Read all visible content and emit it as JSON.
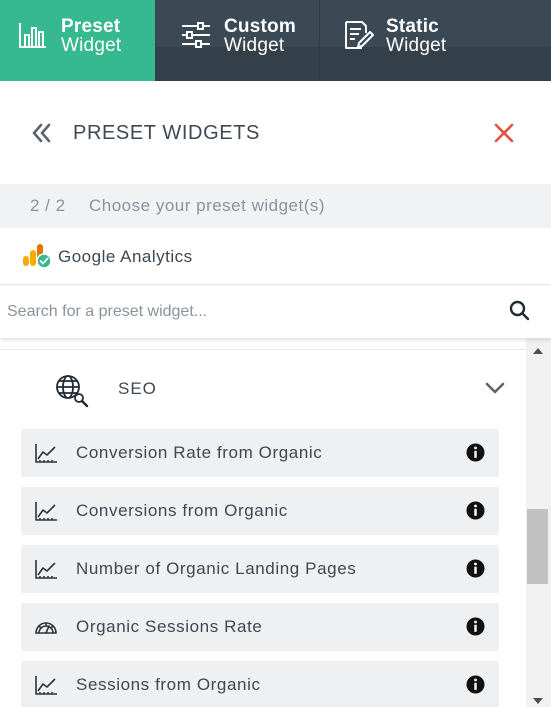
{
  "tabs": [
    {
      "title": "Preset",
      "sub": "Widget",
      "icon": "bar-chart-icon",
      "active": true
    },
    {
      "title": "Custom",
      "sub": "Widget",
      "icon": "sliders-icon",
      "active": false
    },
    {
      "title": "Static",
      "sub": "Widget",
      "icon": "edit-document-icon",
      "active": false
    }
  ],
  "header": {
    "title": "PRESET WIDGETS",
    "back_icon": "double-chevron-left-icon",
    "close_icon": "close-icon"
  },
  "step": {
    "count": "2 / 2",
    "text": "Choose your preset widget(s)"
  },
  "source": {
    "name": "Google Analytics",
    "icon": "google-analytics-icon"
  },
  "search": {
    "placeholder": "Search for a preset widget...",
    "value": ""
  },
  "category": {
    "label": "SEO",
    "icon": "globe-search-icon",
    "expanded": true
  },
  "widgets": [
    {
      "label": "Conversion Rate from Organic",
      "icon": "trend-line-icon"
    },
    {
      "label": "Conversions from Organic",
      "icon": "trend-line-icon"
    },
    {
      "label": "Number of Organic Landing Pages",
      "icon": "trend-line-icon"
    },
    {
      "label": "Organic Sessions Rate",
      "icon": "gauge-icon"
    },
    {
      "label": "Sessions from Organic",
      "icon": "trend-line-icon"
    }
  ],
  "colors": {
    "accent": "#36b98e",
    "tab_bar": "#3b4955",
    "close": "#e0533f",
    "item_bg": "#eef0f2",
    "text": "#3d4853",
    "muted": "#8a939c"
  }
}
